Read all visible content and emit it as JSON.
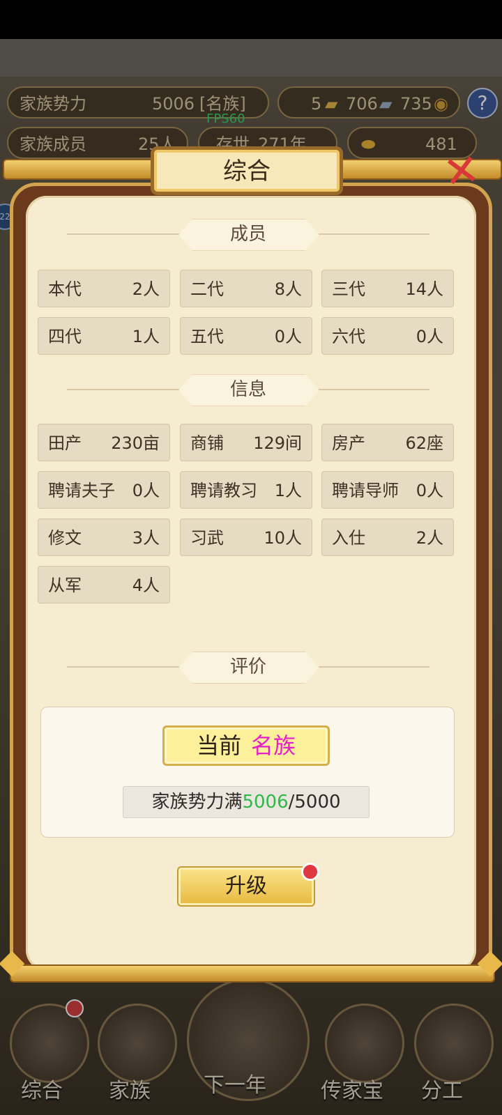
{
  "hud": {
    "power_label": "家族势力",
    "power_value": "5006",
    "power_rank": "[名族]",
    "currency_a": "5",
    "currency_b": "706",
    "currency_c": "735",
    "members_label": "家族成员",
    "members_value": "25人",
    "years_label": "存世",
    "years_value": "271年",
    "gold": "481",
    "fps": "FPS60",
    "help": "?",
    "side_badge": "22"
  },
  "modal": {
    "title": "综合",
    "close": "✕",
    "members_header": "成员",
    "members": [
      {
        "label": "本代",
        "value": "2人"
      },
      {
        "label": "二代",
        "value": "8人"
      },
      {
        "label": "三代",
        "value": "14人"
      },
      {
        "label": "四代",
        "value": "1人"
      },
      {
        "label": "五代",
        "value": "0人"
      },
      {
        "label": "六代",
        "value": "0人"
      }
    ],
    "info_header": "信息",
    "info": [
      {
        "label": "田产",
        "value": "230亩"
      },
      {
        "label": "商铺",
        "value": "129间"
      },
      {
        "label": "房产",
        "value": "62座"
      },
      {
        "label": "聘请夫子",
        "value": "0人"
      },
      {
        "label": "聘请教习",
        "value": "1人"
      },
      {
        "label": "聘请导师",
        "value": "0人"
      },
      {
        "label": "修文",
        "value": "3人"
      },
      {
        "label": "习武",
        "value": "10人"
      },
      {
        "label": "入仕",
        "value": "2人"
      },
      {
        "label": "从军",
        "value": "4人"
      }
    ],
    "eval_header": "评价",
    "rank_prefix": "当前",
    "rank_name": "名族",
    "power_text": "家族势力满",
    "power_current": "5006",
    "power_target": "/5000",
    "upgrade": "升级"
  },
  "nav": {
    "items": [
      "综合",
      "家族",
      "下一年",
      "传家宝",
      "分工"
    ]
  },
  "colors": {
    "rank_name": "#e620c8",
    "power_current": "#2fb84a",
    "close": "#d83838"
  }
}
